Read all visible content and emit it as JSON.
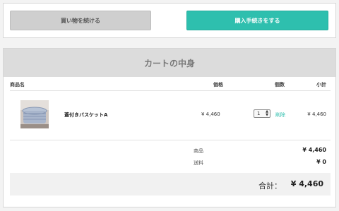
{
  "actions": {
    "continue_label": "買い物を続ける",
    "checkout_label": "購入手続きをする"
  },
  "cart": {
    "title": "カートの中身",
    "columns": {
      "product": "商品名",
      "price": "価格",
      "quantity": "個数",
      "subtotal": "小計"
    },
    "items": [
      {
        "name": "蓋付きバスケットA",
        "price": "¥ 4,460",
        "quantity": "1",
        "delete_label": "削除",
        "subtotal": "¥ 4,460"
      }
    ],
    "summary": {
      "goods_label": "商品",
      "goods_value": "¥ 4,460",
      "shipping_label": "送料",
      "shipping_value": "¥ 0"
    },
    "total": {
      "label": "合計：",
      "value": "¥ 4,460"
    }
  },
  "colors": {
    "accent": "#2ebfae",
    "secondary_button": "#cfcfcf",
    "header_bg": "#dcdcdc"
  }
}
